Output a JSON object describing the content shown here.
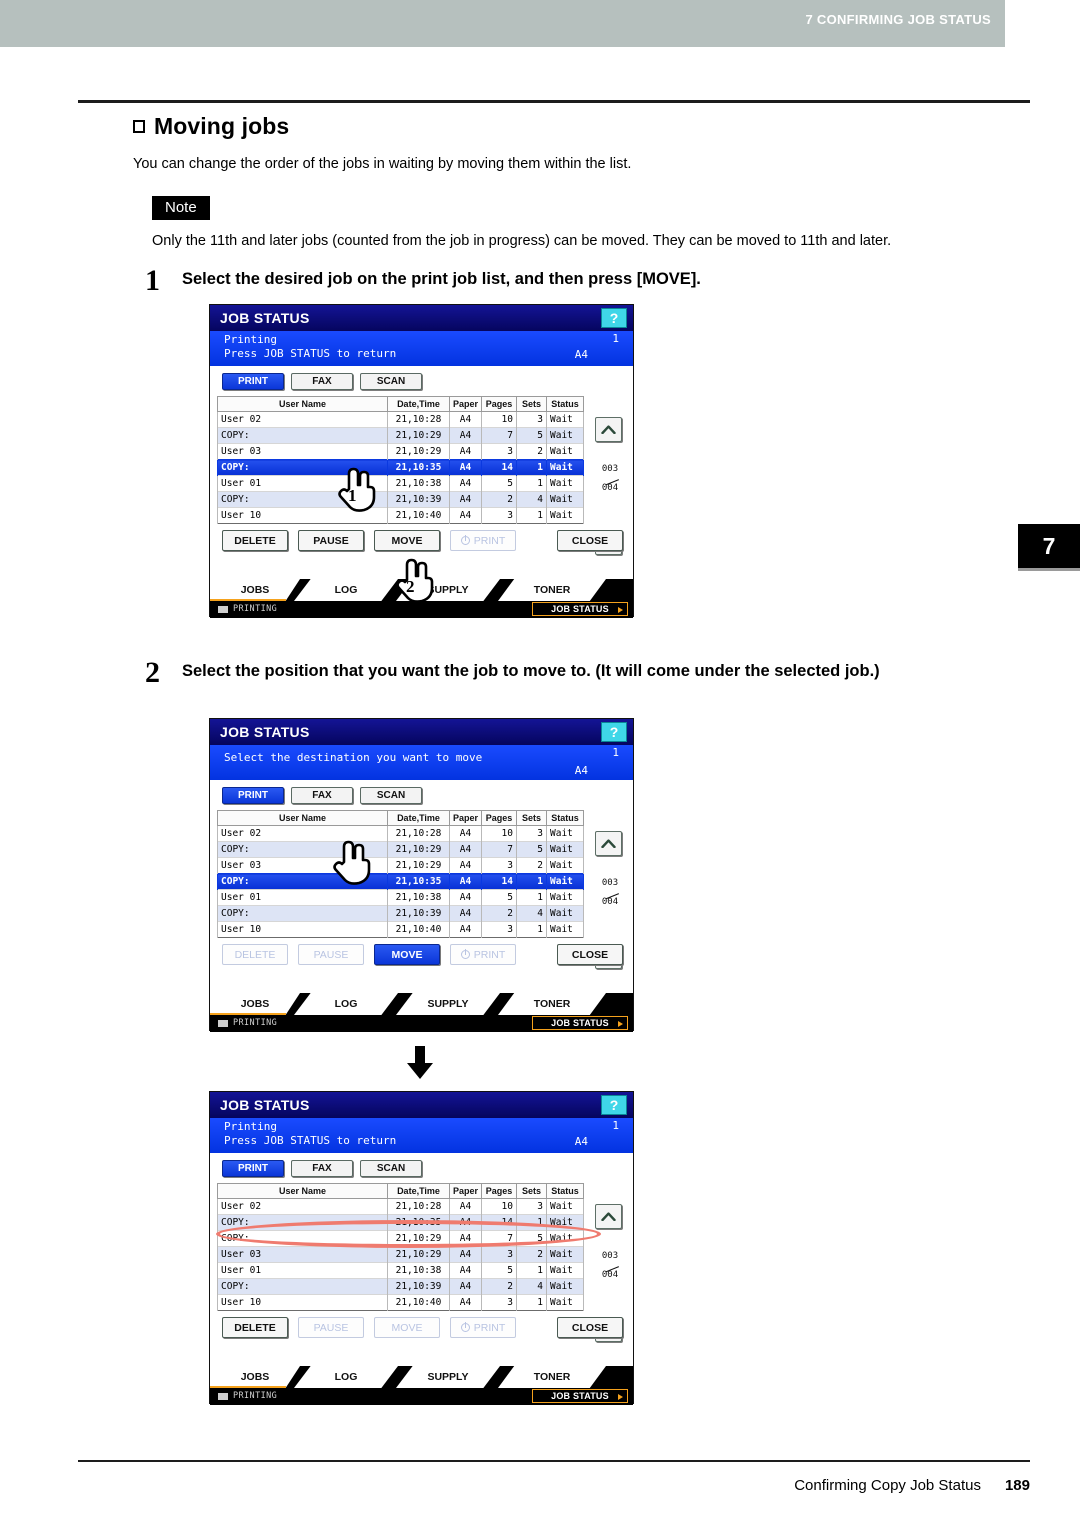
{
  "header": {
    "running_head": "7 CONFIRMING JOB STATUS",
    "chapter_tab": "7"
  },
  "section": {
    "title": "Moving jobs",
    "intro": "You can change the order of the jobs in waiting by moving them within the list.",
    "note_label": "Note",
    "note_text": "Only the 11th and later jobs (counted from the job in progress) can be moved. They can be moved to 11th and later."
  },
  "steps": [
    {
      "number": "1",
      "text": "Select the desired job on the print job list, and then press [MOVE]."
    },
    {
      "number": "2",
      "text": "Select the position that you want the job to move to. (It will come under the selected job.)"
    }
  ],
  "footer": {
    "running_foot": "Confirming Copy Job Status",
    "page_number": "189"
  },
  "lcd_common": {
    "title": "JOB STATUS",
    "help": "?",
    "mode_tabs": [
      "PRINT",
      "FAX",
      "SCAN"
    ],
    "columns": [
      "User Name",
      "Date,Time",
      "Paper",
      "Pages",
      "Sets",
      "Status"
    ],
    "scroll": {
      "current": "003",
      "total": "004"
    },
    "actions": [
      "DELETE",
      "PAUSE",
      "MOVE",
      "PRINT",
      "CLOSE"
    ],
    "bottom_tabs": [
      "JOBS",
      "LOG",
      "SUPPLY",
      "TONER"
    ],
    "foot_status": "PRINTING",
    "foot_button": "JOB STATUS"
  },
  "colors": {
    "title_bar": "#0b0b77",
    "status_bar": "#0b3ff0",
    "selected_row": "#0b39e0",
    "alt_row": "#dde4f5",
    "accent_orange": "#f5a21d",
    "help_cyan": "#3fd6e8",
    "highlight_red": "#ef7b6f",
    "running_head_band": "#b6c0be"
  },
  "panels": [
    {
      "id": "panel1",
      "status_line1": "Printing",
      "status_line2": "Press JOB STATUS to return",
      "status_pages": "1",
      "status_paper": "A4",
      "active_mode": "PRINT",
      "rows": [
        {
          "name": "User 02",
          "date": "21,10:28",
          "paper": "A4",
          "pages": "10",
          "sets": "3",
          "status": "Wait",
          "style": "plain"
        },
        {
          "name": "COPY:",
          "date": "21,10:29",
          "paper": "A4",
          "pages": "7",
          "sets": "5",
          "status": "Wait",
          "style": "alt"
        },
        {
          "name": "User 03",
          "date": "21,10:29",
          "paper": "A4",
          "pages": "3",
          "sets": "2",
          "status": "Wait",
          "style": "plain"
        },
        {
          "name": "COPY:",
          "date": "21,10:35",
          "paper": "A4",
          "pages": "14",
          "sets": "1",
          "status": "Wait",
          "style": "sel"
        },
        {
          "name": "User 01",
          "date": "21,10:38",
          "paper": "A4",
          "pages": "5",
          "sets": "1",
          "status": "Wait",
          "style": "plain"
        },
        {
          "name": "COPY:",
          "date": "21,10:39",
          "paper": "A4",
          "pages": "2",
          "sets": "4",
          "status": "Wait",
          "style": "alt"
        },
        {
          "name": "User 10",
          "date": "21,10:40",
          "paper": "A4",
          "pages": "3",
          "sets": "1",
          "status": "Wait",
          "style": "plain"
        }
      ],
      "action_states": [
        "enabled",
        "enabled",
        "enabled",
        "disabled",
        "enabled"
      ],
      "callouts": [
        "1",
        "2"
      ]
    },
    {
      "id": "panel2",
      "status_line1": "Select the destination you want to move",
      "status_line2": "",
      "status_pages": "1",
      "status_paper": "A4",
      "active_mode": "PRINT",
      "rows": [
        {
          "name": "User 02",
          "date": "21,10:28",
          "paper": "A4",
          "pages": "10",
          "sets": "3",
          "status": "Wait",
          "style": "plain"
        },
        {
          "name": "COPY:",
          "date": "21,10:29",
          "paper": "A4",
          "pages": "7",
          "sets": "5",
          "status": "Wait",
          "style": "alt"
        },
        {
          "name": "User 03",
          "date": "21,10:29",
          "paper": "A4",
          "pages": "3",
          "sets": "2",
          "status": "Wait",
          "style": "plain"
        },
        {
          "name": "COPY:",
          "date": "21,10:35",
          "paper": "A4",
          "pages": "14",
          "sets": "1",
          "status": "Wait",
          "style": "sel"
        },
        {
          "name": "User 01",
          "date": "21,10:38",
          "paper": "A4",
          "pages": "5",
          "sets": "1",
          "status": "Wait",
          "style": "plain"
        },
        {
          "name": "COPY:",
          "date": "21,10:39",
          "paper": "A4",
          "pages": "2",
          "sets": "4",
          "status": "Wait",
          "style": "alt"
        },
        {
          "name": "User 10",
          "date": "21,10:40",
          "paper": "A4",
          "pages": "3",
          "sets": "1",
          "status": "Wait",
          "style": "plain"
        }
      ],
      "action_states": [
        "disabled",
        "disabled",
        "selected",
        "disabled",
        "enabled"
      ],
      "callouts": []
    },
    {
      "id": "panel3",
      "status_line1": "Printing",
      "status_line2": "Press JOB STATUS to return",
      "status_pages": "1",
      "status_paper": "A4",
      "active_mode": "PRINT",
      "rows": [
        {
          "name": "User 02",
          "date": "21,10:28",
          "paper": "A4",
          "pages": "10",
          "sets": "3",
          "status": "Wait",
          "style": "plain"
        },
        {
          "name": "COPY:",
          "date": "21,10:35",
          "paper": "A4",
          "pages": "14",
          "sets": "1",
          "status": "Wait",
          "style": "alt"
        },
        {
          "name": "COPY:",
          "date": "21,10:29",
          "paper": "A4",
          "pages": "7",
          "sets": "5",
          "status": "Wait",
          "style": "plain"
        },
        {
          "name": "User 03",
          "date": "21,10:29",
          "paper": "A4",
          "pages": "3",
          "sets": "2",
          "status": "Wait",
          "style": "alt"
        },
        {
          "name": "User 01",
          "date": "21,10:38",
          "paper": "A4",
          "pages": "5",
          "sets": "1",
          "status": "Wait",
          "style": "plain"
        },
        {
          "name": "COPY:",
          "date": "21,10:39",
          "paper": "A4",
          "pages": "2",
          "sets": "4",
          "status": "Wait",
          "style": "alt"
        },
        {
          "name": "User 10",
          "date": "21,10:40",
          "paper": "A4",
          "pages": "3",
          "sets": "1",
          "status": "Wait",
          "style": "plain"
        }
      ],
      "action_states": [
        "enabled",
        "disabled",
        "disabled",
        "disabled",
        "enabled"
      ],
      "callouts": [],
      "highlight_row_index": 1
    }
  ]
}
